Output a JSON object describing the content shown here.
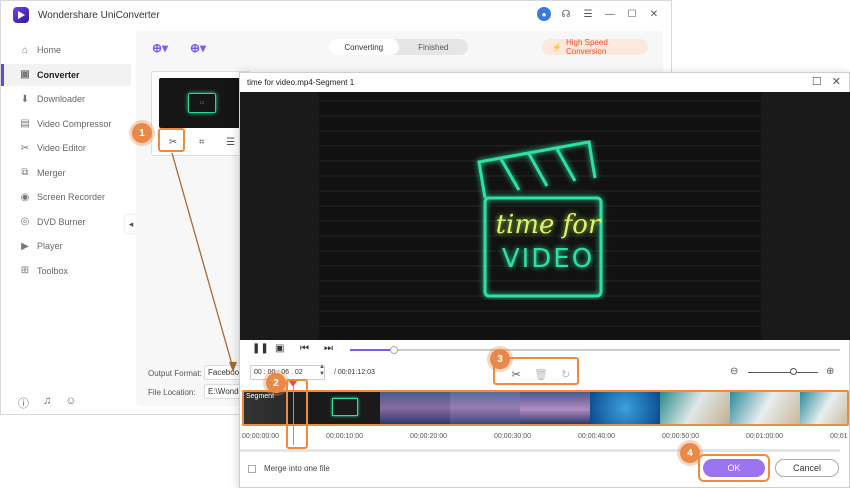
{
  "app": {
    "title": "Wondershare UniConverter"
  },
  "sidebar": {
    "items": [
      {
        "label": "Home",
        "icon": "home-icon",
        "glyph": "⌂"
      },
      {
        "label": "Converter",
        "icon": "converter-icon",
        "glyph": "▣"
      },
      {
        "label": "Downloader",
        "icon": "downloader-icon",
        "glyph": "⬇"
      },
      {
        "label": "Video Compressor",
        "icon": "compressor-icon",
        "glyph": "▤"
      },
      {
        "label": "Video Editor",
        "icon": "scissors-icon",
        "glyph": "✂"
      },
      {
        "label": "Merger",
        "icon": "merger-icon",
        "glyph": "⧉"
      },
      {
        "label": "Screen Recorder",
        "icon": "recorder-icon",
        "glyph": "◉"
      },
      {
        "label": "DVD Burner",
        "icon": "dvd-icon",
        "glyph": "◎"
      },
      {
        "label": "Player",
        "icon": "player-icon",
        "glyph": "▶"
      },
      {
        "label": "Toolbox",
        "icon": "toolbox-icon",
        "glyph": "⊞"
      }
    ],
    "active": "Converter"
  },
  "tabs": {
    "converting": "Converting",
    "finished": "Finished"
  },
  "high_speed": "High Speed Conversion",
  "output": {
    "format_label": "Output Format:",
    "format_value": "Facebook",
    "location_label": "File Location:",
    "location_value": "E:\\Wondershare"
  },
  "dialog": {
    "title": "time for video.mp4-Segment 1",
    "video_text_line1": "time for",
    "video_text_line2": "VIDEO",
    "current_time": "00 : 00 : 06 . 02",
    "duration": "/ 00:01:12:03",
    "segment_label": "Segment",
    "ticks": [
      "00:00:00:00",
      "00:00:10:00",
      "00:00:20:00",
      "00:00:30:00",
      "00:00:40:00",
      "00:00:50:00",
      "00:01:00:00",
      "00:01"
    ],
    "merge_label": "Merge into one file",
    "ok": "OK",
    "cancel": "Cancel",
    "progress": 0.09,
    "zoom": 0.6
  },
  "badges": [
    "1",
    "2",
    "3",
    "4"
  ],
  "colors": {
    "accent": "#7b5cf0",
    "annotation": "#e8894a",
    "ok": "#9b72f0"
  }
}
